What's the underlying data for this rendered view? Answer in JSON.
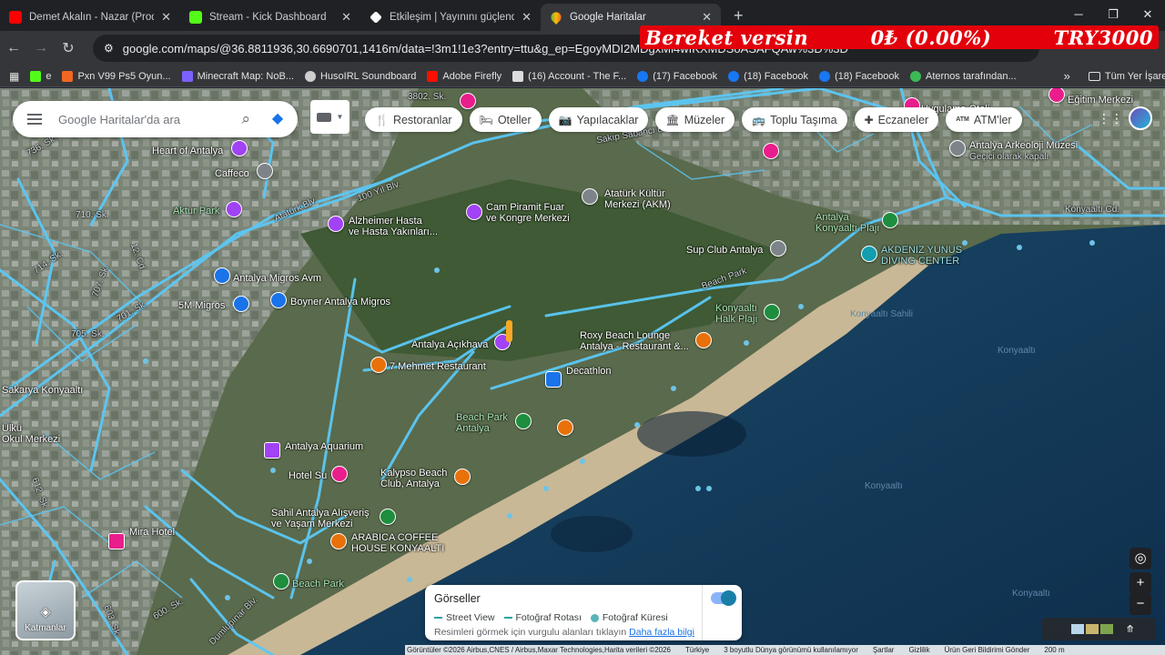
{
  "tabs": [
    {
      "label": "Demet Akalın - Nazar (Prod. Mehmet...",
      "icon": "youtube-icon",
      "color": "#ff0000"
    },
    {
      "label": "Stream - Kick Dashboard",
      "icon": "kick-icon",
      "color": "#53fc18"
    },
    {
      "label": "Etkileşim | Yayınını güçlendirmek...",
      "icon": "diamond-icon",
      "color": "#ffffff"
    },
    {
      "label": "Google Haritalar",
      "icon": "google-maps-icon",
      "color": "#34a853",
      "active": true
    }
  ],
  "address_url": "google.com/maps/@36.8811936,30.6690701,1416m/data=!3m1!1e3?entry=ttu&g_ep=EgoyMDI2MDgxMi4wIKXMDSoASAFQAw%3D%3D",
  "overlay": {
    "left": "Bereket versin",
    "middle": "0₺ (0.00%)",
    "right": "TRY3000"
  },
  "bookmarks": [
    {
      "label": "e",
      "color": "#53fc18"
    },
    {
      "label": "Pxn V99 Ps5 Oyun...",
      "color": "#f26722"
    },
    {
      "label": "Minecraft Map: NoB...",
      "color": "#7b61ff"
    },
    {
      "label": "HusoIRL Soundboard",
      "color": "#cfcfcf"
    },
    {
      "label": "Adobe Firefly",
      "color": "#fa0f00"
    },
    {
      "label": "(16) Account - The F...",
      "color": "#dddddd"
    },
    {
      "label": "(17) Facebook",
      "color": "#1877f2"
    },
    {
      "label": "(18) Facebook",
      "color": "#1877f2"
    },
    {
      "label": "(18) Facebook",
      "color": "#1877f2"
    },
    {
      "label": "Aternos tarafından...",
      "color": "#3cba54"
    }
  ],
  "bookmarks_more": "»",
  "all_bookmarks": "Tüm Yer İşaretleri",
  "search": {
    "placeholder": "Google Haritalar'da ara"
  },
  "chips": [
    {
      "label": "Restoranlar",
      "icon": "🍴"
    },
    {
      "label": "Oteller",
      "icon": "🛏"
    },
    {
      "label": "Yapılacaklar",
      "icon": "📷"
    },
    {
      "label": "Müzeler",
      "icon": "🏛"
    },
    {
      "label": "Toplu Taşıma",
      "icon": "🚌"
    },
    {
      "label": "Eczaneler",
      "icon": "✚"
    },
    {
      "label": "ATM'ler",
      "icon": "ATM"
    }
  ],
  "map_labels": {
    "heart_of_antalya": "Heart of Antalya",
    "caffeco": "Caffeco",
    "aktur_park": "Aktur Park",
    "alzheimer": "Alzheimer Hasta\nve Hasta Yakınları...",
    "cam_piramit": "Cam Piramit Fuar\nve Kongre Merkezi",
    "ataturk_kultur": "Atatürk Kültür\nMerkezi (AKM)",
    "sakip_sabanci": "Sakıp Sabancı Blv.",
    "ataturk_blv": "Atatürk Blv.",
    "yuz_yil_blv": "100 Yıl Blv.",
    "sup_club": "Sup Club Antalya",
    "konyaalti_plaji": "Antalya\nKonyaaltı Plajı",
    "akdeniz_yunus": "AKDENIZ YUNUS\nDIVING CENTER",
    "arkeoloji": "Antalya Arkeoloji Müzesi",
    "gecici": "Geçici olarak kapalı",
    "konyaalti_cd": "Konyaaltı Cd.",
    "beach_park": "Beach Park",
    "halk_plaji": "Konyaaltı\nHalk Plajı",
    "migros_avm": "Antalya Migros Avm",
    "migros_5m": "5M Migros",
    "boyner": "Boyner Antalya Migros",
    "acikhava": "Antalya Açıkhava",
    "roxy": "Roxy Beach Lounge\nAntalya - Restaurant &...",
    "decathlon": "Decathlon",
    "mehmet": "7 Mehmet Restaurant",
    "beach_park_antalya": "Beach Park\nAntalya",
    "aquarium": "Antalya Aquarium",
    "hotel_su": "Hotel Su",
    "kalypso": "Kalypso Beach\nClub, Antalya",
    "sahil": "Sahil Antalya Alışveriş\nve Yaşam Merkezi",
    "arabica": "ARABICA COFFEE\nHOUSE KONYAALTI",
    "mira": "Mira Hotel",
    "beach_park2": "Beach Park",
    "dumlupinar": "Dumlupınar Blv.",
    "egitim": "Eğitim Merkezi",
    "uygulama": "Uygulama Oteli",
    "ulku": "Ülkü",
    "skalk": "Sakarya Konyaaltı",
    "okul": "Okul Merkezi"
  },
  "street_labels": [
    "736. Sk.",
    "710. Sk.",
    "714. Sk.",
    "707. Sk.",
    "705. Sk.",
    "600. Sk.",
    "612. Sk.",
    "603. Sk.",
    "701. Sk.",
    "3802. Sk.",
    "12. Cd."
  ],
  "water_labels": [
    "Konyaaltı Sahili",
    "Konyaaltı",
    "Konyaaltı",
    "Konyaaltı"
  ],
  "layers_label": "Katmanlar",
  "imagery": {
    "title": "Görseller",
    "street_view": "Street View",
    "photo_route": "Fotoğraf Rotası",
    "photo_sphere": "Fotoğraf Küresi",
    "note": "Resimleri görmek için vurgulu alanları tıklayın",
    "more_link": "Daha fazla bilgi"
  },
  "footer": [
    "Görüntüler ©2026 Airbus,CNES / Airbus,Maxar Technologies,Harita verileri ©2026",
    "Türkiye",
    "3 boyutlu Dünya görünümü kullanılamıyor",
    "Şartlar",
    "Gizlilik",
    "Ürün Geri Bildirimi Gönder",
    "200 m"
  ],
  "colors": {
    "road_highlight": "#5bc8f5",
    "sea": "#12395a",
    "accent": "#1a73e8",
    "overlay_bg": "#e3000b"
  }
}
